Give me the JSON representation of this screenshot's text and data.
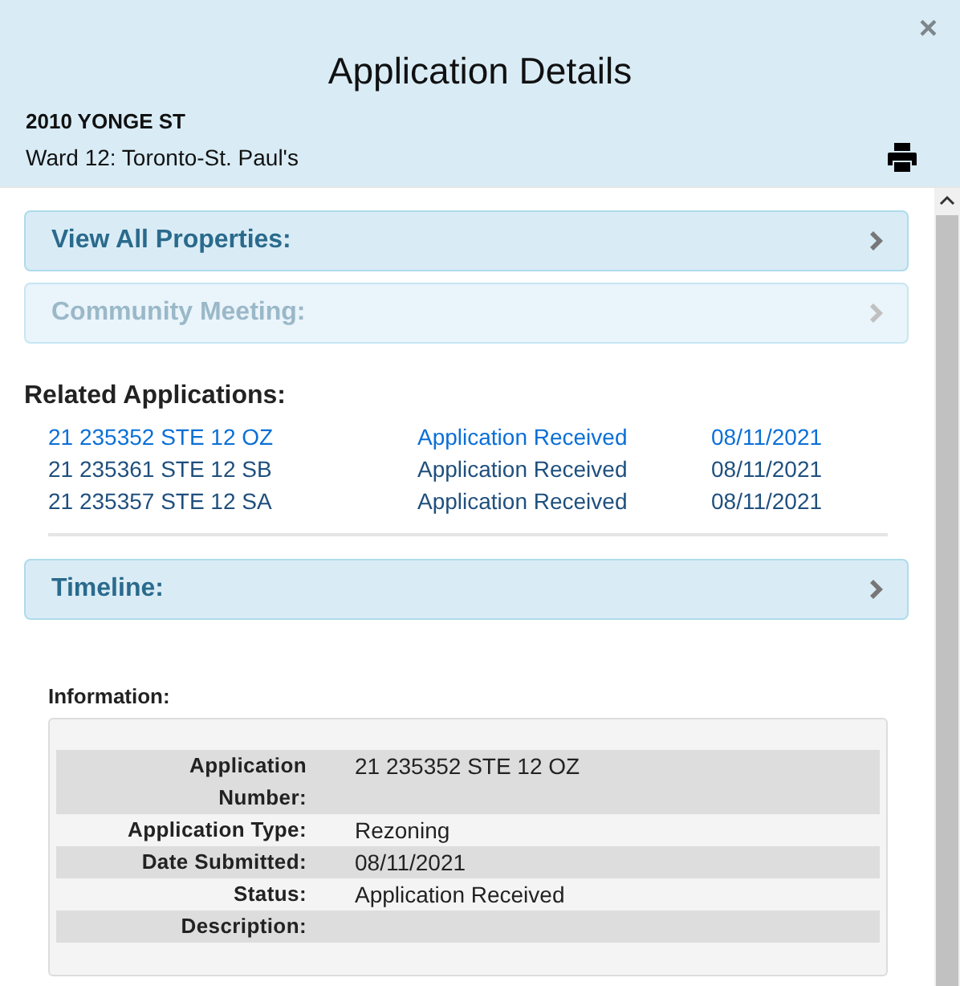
{
  "dialog": {
    "title": "Application Details",
    "close": "×",
    "address": "2010 YONGE ST",
    "ward": "Ward 12: Toronto-St. Paul's"
  },
  "panels": [
    {
      "label": "View All Properties:",
      "disabled": false
    },
    {
      "label": "Community Meeting:",
      "disabled": true
    }
  ],
  "related_applications": {
    "heading": "Related Applications:",
    "rows": [
      {
        "number": "21 235352 STE 12 OZ",
        "status": "Application Received",
        "date": "08/11/2021",
        "selected": true
      },
      {
        "number": "21 235361 STE 12 SB",
        "status": "Application Received",
        "date": "08/11/2021",
        "selected": false
      },
      {
        "number": "21 235357 STE 12 SA",
        "status": "Application Received",
        "date": "08/11/2021",
        "selected": false
      }
    ]
  },
  "timeline": {
    "label": "Timeline:",
    "disabled": false
  },
  "information": {
    "heading": "Information:",
    "rows": [
      {
        "label": "Application Number:",
        "value": "21 235352 STE 12 OZ"
      },
      {
        "label": "Application Type:",
        "value": "Rezoning"
      },
      {
        "label": "Date Submitted:",
        "value": "08/11/2021"
      },
      {
        "label": "Status:",
        "value": "Application Received"
      },
      {
        "label": "Description:",
        "value": ""
      }
    ]
  }
}
